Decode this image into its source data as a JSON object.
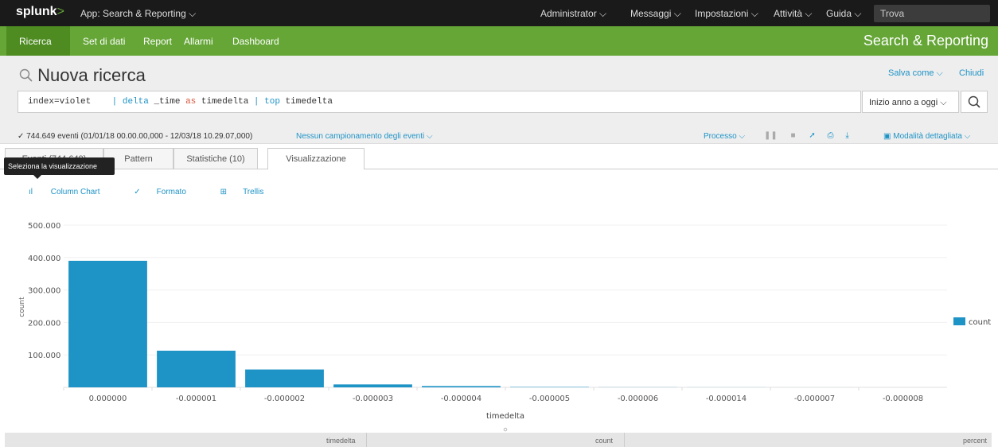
{
  "topbar": {
    "logo": "splunk",
    "logo_gt": ">",
    "app_menu": "App: Search & Reporting ⌵",
    "menus": [
      "Administrator ⌵",
      "Messaggi ⌵",
      "Impostazioni ⌵",
      "Attività ⌵",
      "Guida ⌵"
    ],
    "search_label": "Trova"
  },
  "nav": {
    "items": [
      "Ricerca",
      "Set di dati",
      "Report",
      "Allarmi",
      "Dashboard"
    ],
    "app_title": "Search & Reporting"
  },
  "search": {
    "title": "Nuova ricerca",
    "save_as": "Salva come ⌵",
    "close": "Chiudi",
    "q_index": "index=violet",
    "q_pipe1": "|",
    "q_delta": "delta",
    "q_time": " _time ",
    "q_as": "as",
    "q_td": " timedelta ",
    "q_pipe2": "|",
    "q_top": "top",
    "q_td2": " timedelta",
    "time_range": "Inizio anno a oggi ⌵",
    "status": "✓ 744.649 eventi (01/01/18 00.00.00,000 - 12/03/18 10.29.07,000)",
    "sampling": "Nessun campionamento degli eventi ⌵",
    "job": "Processo ⌵",
    "mode": "Modalità dettagliata ⌵"
  },
  "tabs": {
    "events": "Eventi (744.649)",
    "patterns": "Pattern",
    "stats": "Statistiche (10)",
    "viz": "Visualizzazione",
    "tooltip": "Seleziona la visualizzazione"
  },
  "viz_toolbar": {
    "chart_type": "Column Chart",
    "format": "Formato",
    "trellis": "Trellis"
  },
  "chart_data": {
    "type": "bar",
    "categories": [
      "0.000000",
      "-0.000001",
      "-0.000002",
      "-0.000003",
      "-0.000004",
      "-0.000005",
      "-0.000006",
      "-0.000014",
      "-0.000007",
      "-0.000008"
    ],
    "series": [
      {
        "name": "count",
        "values": [
          390000,
          113000,
          55000,
          9000,
          4000,
          1200,
          400,
          200,
          100,
          50
        ]
      }
    ],
    "xlabel": "timedelta",
    "ylabel": "count",
    "yticks": [
      "100.000",
      "200.000",
      "300.000",
      "400.000",
      "500.000"
    ],
    "ylim": [
      0,
      500000
    ],
    "legend": "right",
    "color": "#1e93c6"
  },
  "table_header": [
    "timedelta",
    "count",
    "percent"
  ],
  "colors": {
    "brand_green": "#65a637",
    "accent_blue": "#1e93c6"
  }
}
